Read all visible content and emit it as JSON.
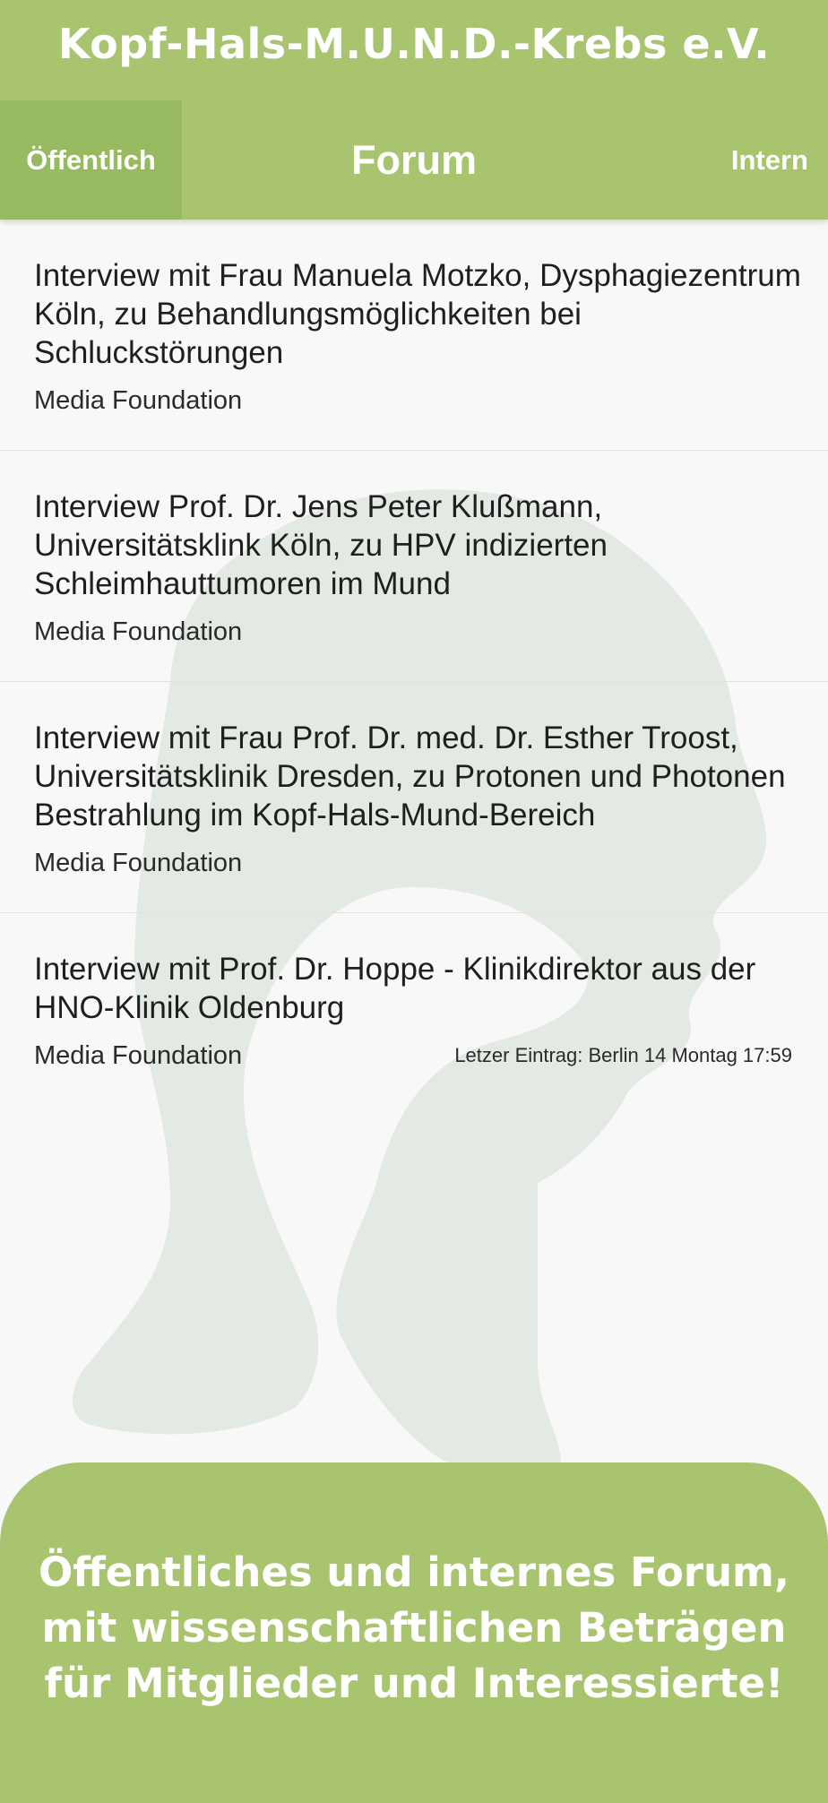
{
  "header": {
    "app_title": "Kopf-Hals-M.U.N.D.-Krebs e.V.",
    "tab_public": "Öffentlich",
    "nav_title": "Forum",
    "tab_internal": "Intern"
  },
  "forum": {
    "items": [
      {
        "title": "Interview mit Frau Manuela Motzko, Dysphagiezentrum Köln, zu Behandlungsmöglichkeiten bei Schluckstörungen",
        "source": "Media Foundation"
      },
      {
        "title": "Interview Prof. Dr. Jens Peter Klußmann, Universitätsklink Köln, zu HPV indizierten Schleimhauttumoren im Mund",
        "source": "Media Foundation"
      },
      {
        "title": "Interview mit Frau Prof. Dr. med. Dr. Esther Troost, Universitätsklinik Dresden, zu Protonen und Photonen Bestrahlung im Kopf-Hals-Mund-Bereich",
        "source": "Media Foundation"
      },
      {
        "title": "Interview mit Prof. Dr. Hoppe - Klinikdirektor aus der HNO-Klinik Oldenburg",
        "source": "Media Foundation",
        "last_entry": "Letzer Eintrag: Berlin 14 Montag 17:59"
      }
    ]
  },
  "promo": {
    "line1": "Öffentliches und internes Forum,",
    "line2": "mit wissenschaftlichen Beträgen",
    "line3": "für Mitglieder und Interessierte!"
  },
  "colors": {
    "brand_green": "#a8c46e",
    "active_tab_green": "#97b960",
    "watermark": "#e2e8e2"
  },
  "icons": {
    "watermark": "head-profile-silhouette"
  }
}
